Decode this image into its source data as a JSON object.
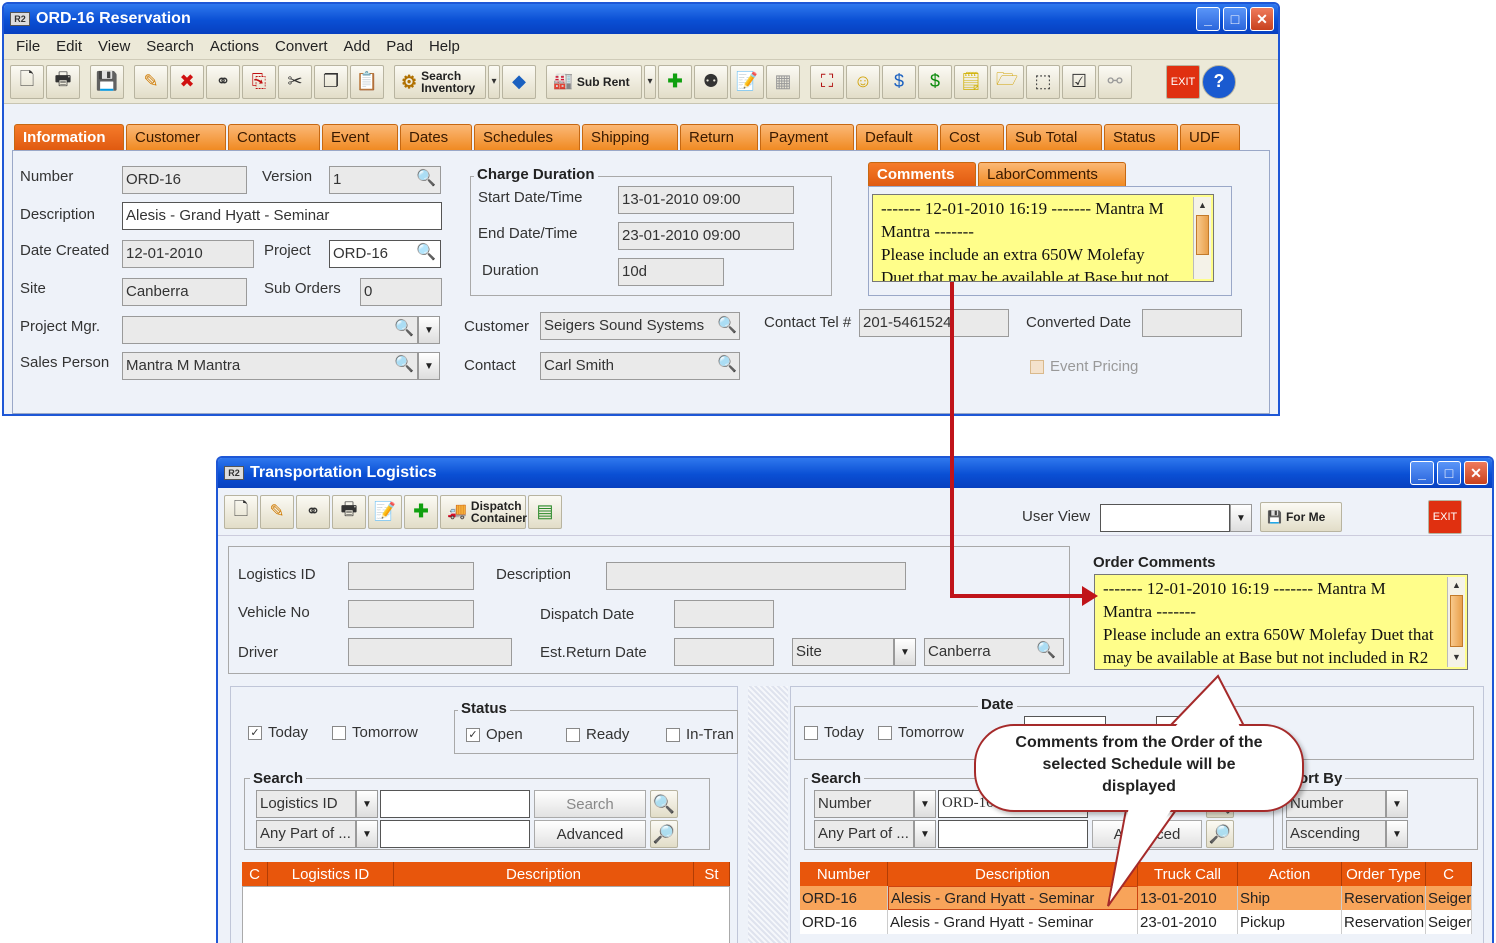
{
  "win1": {
    "title": "ORD-16 Reservation",
    "menu": [
      "File",
      "Edit",
      "View",
      "Search",
      "Actions",
      "Convert",
      "Add",
      "Pad",
      "Help"
    ],
    "toolbar": {
      "search_inventory": "Search Inventory",
      "sub_rent": "Sub Rent",
      "exit": "EXIT"
    },
    "tabs": [
      "Information",
      "Customer",
      "Contacts",
      "Event",
      "Dates",
      "Schedules",
      "Shipping",
      "Return",
      "Payment",
      "Default",
      "Cost",
      "Sub Total",
      "Status",
      "UDF"
    ],
    "fields": {
      "number_label": "Number",
      "number": "ORD-16",
      "version_label": "Version",
      "version": "1",
      "description_label": "Description",
      "description": "Alesis - Grand Hyatt - Seminar",
      "date_created_label": "Date Created",
      "date_created": "12-01-2010",
      "project_label": "Project",
      "project": "ORD-16",
      "site_label": "Site",
      "site": "Canberra",
      "sub_orders_label": "Sub Orders",
      "sub_orders": "0",
      "project_mgr_label": "Project Mgr.",
      "project_mgr": "",
      "sales_person_label": "Sales Person",
      "sales_person": "Mantra M Mantra",
      "charge_duration_title": "Charge Duration",
      "start_label": "Start Date/Time",
      "start": "13-01-2010 09:00",
      "end_label": "End Date/Time",
      "end": "23-01-2010 09:00",
      "duration_label": "Duration",
      "duration": "10d",
      "customer_label": "Customer",
      "customer": "Seigers Sound Systems",
      "contact_label": "Contact",
      "contact": "Carl Smith",
      "contact_tel_label": "Contact Tel #",
      "contact_tel": "201-5461524",
      "converted_date_label": "Converted Date",
      "converted_date": "",
      "event_pricing": "Event Pricing"
    },
    "comment_tabs": [
      "Comments",
      "LaborComments"
    ],
    "comment_lines": [
      "------- 12-01-2010 16:19 ------- Mantra M",
      "Mantra -------",
      "Please include an extra 650W Molefay",
      "Duet that may be available at Base but not"
    ]
  },
  "win2": {
    "title": "Transportation Logistics",
    "toolbar": {
      "dispatch": "Dispatch Container",
      "user_view_label": "User View",
      "user_view": "",
      "for_me": "For Me",
      "exit": "EXIT"
    },
    "fields": {
      "logistics_id_label": "Logistics ID",
      "logistics_id": "",
      "description_label": "Description",
      "description": "",
      "vehicle_label": "Vehicle No",
      "vehicle": "",
      "dispatch_label": "Dispatch Date",
      "dispatch": "",
      "driver_label": "Driver",
      "driver": "",
      "est_return_label": "Est.Return Date",
      "est_return": "",
      "site_select": "Site",
      "site": "Canberra"
    },
    "order_comments_title": "Order Comments",
    "order_comment_lines": [
      "------- 12-01-2010 16:19 ------- Mantra M",
      "Mantra -------",
      "Please include an extra 650W Molefay Duet that",
      "may be available at Base but not included in R2"
    ],
    "left": {
      "today": "Today",
      "tomorrow": "Tomorrow",
      "status_title": "Status",
      "open": "Open",
      "ready": "Ready",
      "in_transit": "In-Tran",
      "search_title": "Search",
      "search_by": "Logistics ID",
      "match": "Any Part of ...",
      "search_btn": "Search",
      "advanced_btn": "Advanced",
      "columns": [
        "C",
        "Logistics ID",
        "Description",
        "St"
      ]
    },
    "right": {
      "today": "Today",
      "tomorrow": "Tomorrow",
      "date_title": "Date",
      "search_title": "Search",
      "search_by": "Number",
      "search_value": "ORD-16",
      "match": "Any Part of ...",
      "advanced_btn": "Advanced",
      "sort_title": "Sort By",
      "sort_field": "Number",
      "sort_order": "Ascending",
      "columns": [
        "Number",
        "Description",
        "Truck Call",
        "Action",
        "Order Type",
        "C"
      ],
      "rows": [
        [
          "ORD-16",
          "Alesis - Grand Hyatt - Seminar",
          "13-01-2010",
          "Ship",
          "Reservation",
          "Seiger"
        ],
        [
          "ORD-16",
          "Alesis - Grand Hyatt - Seminar",
          "23-01-2010",
          "Pickup",
          "Reservation",
          "Seiger"
        ]
      ]
    }
  },
  "callout": {
    "line1": "Comments from the Order of the",
    "line2": "selected Schedule will be",
    "line3": "displayed"
  },
  "colors": {
    "accent": "#e8560c",
    "titlebar": "#0a4fd4",
    "comment_bg": "#fffe8a",
    "arrow": "#c0141a"
  }
}
